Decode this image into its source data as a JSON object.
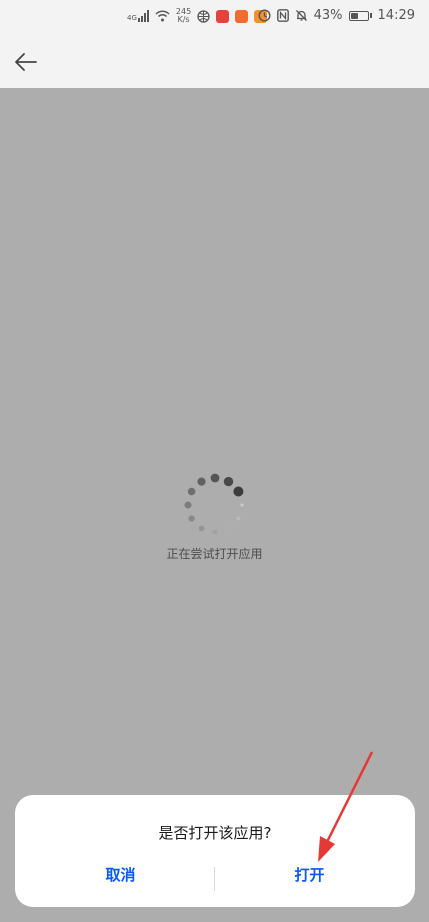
{
  "status_bar": {
    "network": "4G",
    "speed_value": "245",
    "speed_unit": "K/s",
    "battery": "43%",
    "battery_level": 0.43,
    "time": "14:29"
  },
  "loading": {
    "text": "正在尝试打开应用"
  },
  "dialog": {
    "title": "是否打开该应用?",
    "cancel_label": "取消",
    "open_label": "打开"
  },
  "colors": {
    "overlay": "#adadad",
    "accent": "#0a59f7",
    "annotation_arrow": "#e53935"
  }
}
